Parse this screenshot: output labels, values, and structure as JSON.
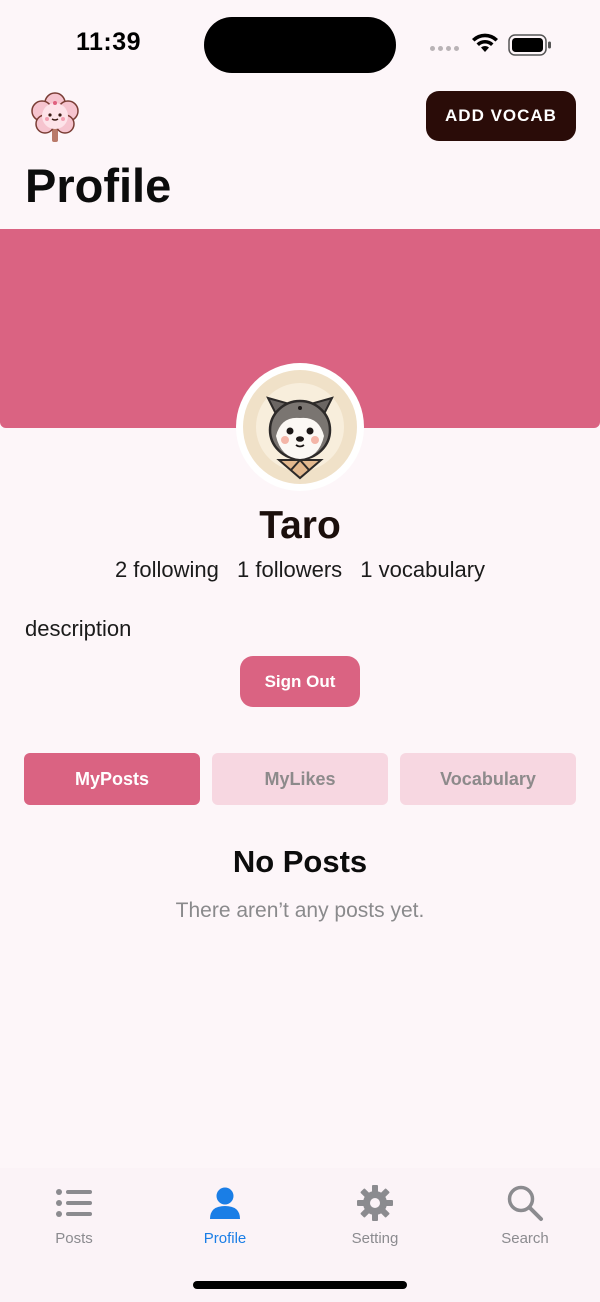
{
  "status_bar": {
    "time": "11:39"
  },
  "header": {
    "add_vocab_label": "ADD VOCAB",
    "title": "Profile"
  },
  "profile": {
    "username": "Taro",
    "following": "2 following",
    "followers": "1 followers",
    "vocabulary_count": "1 vocabulary",
    "description": "description",
    "sign_out_label": "Sign Out"
  },
  "tabs": [
    {
      "label": "MyPosts",
      "active": true
    },
    {
      "label": "MyLikes",
      "active": false
    },
    {
      "label": "Vocabulary",
      "active": false
    }
  ],
  "empty_state": {
    "title": "No Posts",
    "subtitle": "There aren’t any posts yet."
  },
  "tabbar": [
    {
      "label": "Posts",
      "icon": "list-icon"
    },
    {
      "label": "Profile",
      "icon": "person-icon",
      "active": true
    },
    {
      "label": "Setting",
      "icon": "gear-icon"
    },
    {
      "label": "Search",
      "icon": "search-icon"
    }
  ],
  "colors": {
    "accent": "#da6382",
    "dark_button": "#2a0c08",
    "tab_inactive": "#f7d7e1",
    "tabbar_active": "#1a7ee6"
  }
}
